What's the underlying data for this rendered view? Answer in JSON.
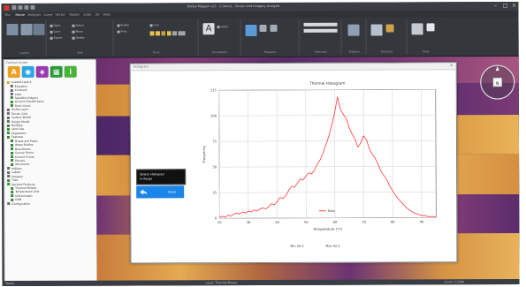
{
  "window": {
    "title": "Global Mapper v22 - 2 (Auto) - Terrain and Imagery Analysis"
  },
  "menu_tabs": [
    {
      "label": "File",
      "active": false
    },
    {
      "label": "Home",
      "active": true
    },
    {
      "label": "Analysis",
      "active": false
    },
    {
      "label": "Layer",
      "active": false
    },
    {
      "label": "Vector",
      "active": false
    },
    {
      "label": "Raster",
      "active": false
    },
    {
      "label": "Lidar",
      "active": false
    },
    {
      "label": "3D",
      "active": false
    },
    {
      "label": "Help",
      "active": false
    }
  ],
  "ribbon": {
    "groups": [
      {
        "label": "Layers"
      },
      {
        "label": "Edit"
      },
      {
        "label": "Tools"
      },
      {
        "label": "Annotation"
      },
      {
        "label": "Measure"
      },
      {
        "label": "Features"
      },
      {
        "label": "Digitize"
      },
      {
        "label": "Analysis"
      },
      {
        "label": "View"
      }
    ],
    "small_items": [
      "Open",
      "Save",
      "Export",
      "Select",
      "Move",
      "Delete",
      "Profile",
      "Area",
      "Line",
      "Label",
      "Edit",
      "View"
    ]
  },
  "left_panel": {
    "title": "Control Center",
    "tools": [
      {
        "icon": "letter-a-icon",
        "glyph": "A",
        "color": "#f0a020"
      },
      {
        "icon": "globe-icon",
        "glyph": "◉",
        "color": "#2aa6e6"
      },
      {
        "icon": "layers-icon",
        "glyph": "◈",
        "color": "#9a3ab0"
      },
      {
        "icon": "grid-icon",
        "glyph": "▦",
        "color": "#2c9a3c"
      },
      {
        "icon": "info-icon",
        "glyph": "i",
        "color": "#4ab13a"
      }
    ],
    "tree_items": [
      {
        "label": "Loaded Layers",
        "color": "#e0a030",
        "indent": 0
      },
      {
        "label": "Elevation",
        "color": "#6a6a6a",
        "indent": 1
      },
      {
        "label": "Contours",
        "color": "#6a6a6a",
        "indent": 1
      },
      {
        "label": "Lidar",
        "color": "#6a6a6a",
        "indent": 1
      },
      {
        "label": "Satellite Imagery",
        "color": "#3a8a3a",
        "indent": 1
      },
      {
        "label": "Ground Classification",
        "color": "#3a8a3a",
        "indent": 1
      },
      {
        "label": "Point Cloud",
        "color": "#3a8a3a",
        "indent": 1
      },
      {
        "label": "Profile Layer",
        "color": "#6a6a6a",
        "indent": 0
      },
      {
        "label": "Terrain Grid",
        "color": "#6a6a6a",
        "indent": 0
      },
      {
        "label": "Surface Model",
        "color": "#6a6a6a",
        "indent": 0
      },
      {
        "label": "Height Model",
        "color": "#6a6a6a",
        "indent": 0
      },
      {
        "label": "Building",
        "color": "#3a8a3a",
        "indent": 0
      },
      {
        "label": "Land Use",
        "color": "#3a8a3a",
        "indent": 0
      },
      {
        "label": "Vegetation",
        "color": "#3a8a3a",
        "indent": 0
      },
      {
        "label": "Features",
        "color": "#3a8a3a",
        "indent": 0
      },
      {
        "label": "Roads and Paths",
        "color": "#3a8a3a",
        "indent": 1
      },
      {
        "label": "Water Bodies",
        "color": "#3a8a3a",
        "indent": 1
      },
      {
        "label": "Boundaries",
        "color": "#3a8a3a",
        "indent": 1
      },
      {
        "label": "Survey Points",
        "color": "#3a8a3a",
        "indent": 1
      },
      {
        "label": "Control Points",
        "color": "#3a8a3a",
        "indent": 1
      },
      {
        "label": "Parcels",
        "color": "#3a8a3a",
        "indent": 1
      },
      {
        "label": "Structures",
        "color": "#3a8a3a",
        "indent": 1
      },
      {
        "label": "Utilities",
        "color": "#6a6a6a",
        "indent": 0
      },
      {
        "label": "Labels",
        "color": "#6a6a6a",
        "indent": 0
      },
      {
        "label": "Imagery",
        "color": "#6a6a6a",
        "indent": 0
      },
      {
        "label": "Tiles",
        "color": "#3a8a3a",
        "indent": 0
      },
      {
        "label": "Derived Products",
        "color": "#3a8a3a",
        "indent": 0
      },
      {
        "label": "Thermal Mosaic",
        "color": "#3a8a3a",
        "indent": 1
      },
      {
        "label": "Temperature Grid",
        "color": "#3a8a3a",
        "indent": 1
      },
      {
        "label": "Orthomosaic",
        "color": "#3a8a3a",
        "indent": 1
      },
      {
        "label": "DSM",
        "color": "#3a8a3a",
        "indent": 1
      },
      {
        "label": "Configuration",
        "color": "#6a6a6a",
        "indent": 0
      }
    ]
  },
  "dialog": {
    "title": "Histogram",
    "close_glyph": "×",
    "readouts": [
      {
        "label": "Min",
        "value": "20.2"
      },
      {
        "label": "Max",
        "value": "92.5"
      }
    ]
  },
  "side_buttons": {
    "primary": "Stretch Histogram",
    "primary_sub": "to Range",
    "secondary": "Reset"
  },
  "compass": {
    "label": "N"
  },
  "status": {
    "left": "Ready",
    "middle": "Layer: Thermal Mosaic",
    "right": "Zoom: 1:2500"
  },
  "colors": {
    "series": "#ff3b3b",
    "accent": "#1c86e8",
    "imagery_dark": "#4b2a6e",
    "imagery_warm": "#e0a040"
  },
  "chart_data": {
    "type": "line",
    "title": "Thermal Histogram",
    "xlabel": "Temperature (°C)",
    "ylabel": "Frequency",
    "xlim": [
      20,
      95
    ],
    "ylim": [
      0,
      125
    ],
    "xticks": [
      20,
      30,
      40,
      50,
      60,
      70,
      80,
      90
    ],
    "yticks": [
      0,
      25,
      50,
      75,
      100,
      125
    ],
    "legend": "center-bottom",
    "grid": true,
    "series": [
      {
        "name": "Data",
        "color": "#ff3b3b",
        "x": [
          20,
          21,
          22,
          23,
          24,
          25,
          26,
          27,
          28,
          29,
          30,
          31,
          32,
          33,
          34,
          35,
          36,
          37,
          38,
          39,
          40,
          41,
          42,
          43,
          44,
          45,
          46,
          47,
          48,
          49,
          50,
          51,
          52,
          53,
          54,
          55,
          56,
          57,
          58,
          59,
          60,
          61,
          62,
          63,
          64,
          65,
          66,
          67,
          68,
          69,
          70,
          71,
          72,
          73,
          74,
          75,
          76,
          77,
          78,
          79,
          80,
          81,
          82,
          83,
          84,
          85,
          86,
          87,
          88,
          89,
          90,
          91,
          92,
          93,
          94,
          95
        ],
        "y": [
          1,
          2,
          1,
          3,
          2,
          4,
          5,
          4,
          6,
          5,
          7,
          6,
          8,
          7,
          9,
          10,
          9,
          11,
          14,
          13,
          16,
          20,
          19,
          22,
          27,
          31,
          30,
          34,
          38,
          37,
          41,
          44,
          43,
          47,
          53,
          57,
          64,
          72,
          80,
          91,
          103,
          118,
          106,
          101,
          97,
          88,
          82,
          77,
          69,
          73,
          80,
          76,
          67,
          62,
          58,
          52,
          45,
          41,
          37,
          31,
          26,
          22,
          18,
          15,
          12,
          9,
          7,
          5,
          4,
          3,
          2,
          2,
          1,
          1,
          1,
          0
        ]
      }
    ]
  }
}
